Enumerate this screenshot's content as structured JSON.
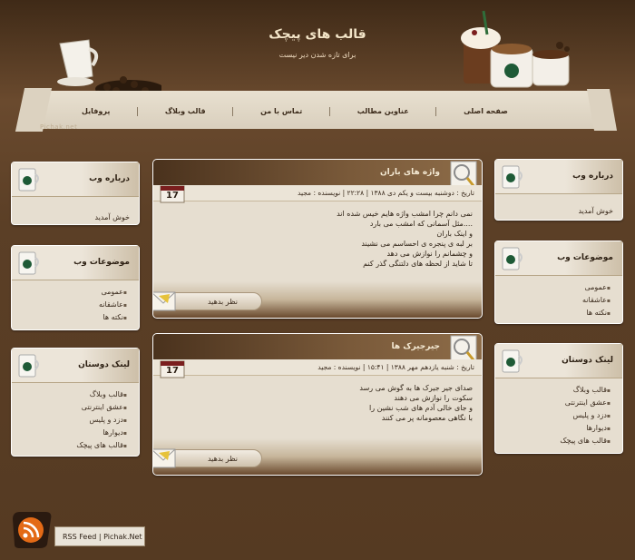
{
  "header": {
    "title": "قالب های پیچک",
    "description": "برای تازه شدن دیر نیست",
    "brand": "Pichak.net"
  },
  "nav": {
    "items": [
      "صفحه اصلی",
      "عناوین مطالب",
      "تماس با من",
      "قالب وبلاگ",
      "پروفایل"
    ]
  },
  "right_sidebar": {
    "about": {
      "title": "درباره وب",
      "text": "خوش آمدید"
    },
    "topics": {
      "title": "موضوعات وب",
      "items": [
        "عمومی",
        "عاشقانه",
        "نکته ها"
      ]
    },
    "links": {
      "title": "لینک دوستان",
      "items": [
        "قالب وبلاگ",
        "عشق اینترنتی",
        "دزد و پلیس",
        "دیوارها",
        "قالب های پیچک"
      ]
    }
  },
  "left_sidebar": {
    "about": {
      "title": "درباره وب",
      "text": "خوش آمدید"
    },
    "topics": {
      "title": "موضوعات وب",
      "items": [
        "عمومی",
        "عاشقانه",
        "نکته ها"
      ]
    },
    "links": {
      "title": "لینک دوستان",
      "items": [
        "قالب وبلاگ",
        "عشق اینترنتی",
        "دزد و پلیس",
        "دیوارها",
        "قالب های پیچک"
      ]
    }
  },
  "posts": [
    {
      "title": "واژه های باران",
      "day": "17",
      "meta": "تاریخ : دوشنبه بیست و یکم دی ۱۳۸۸ | ۲۲:۲۸ | نویسنده : مجید",
      "lines": [
        "نمی دانم چرا امشب واژه هایم خیس شده اند",
        "مثل آسمانی که امشب می بارد....",
        "و اینک باران",
        "بر لبه ی پنجره ی احساسم می نشیند",
        "و چشمانم را نوازش می دهد",
        "تا شاید از لحظه های دلتنگی گذر کنم"
      ],
      "comment_label": "نظر بدهید"
    },
    {
      "title": "جیرجیرک ها",
      "day": "17",
      "meta": "تاریخ : شنبه یازدهم مهر ۱۳۸۸ | ۱۵:۴۱ | نویسنده : مجید",
      "lines": [
        "صدای جیر جیرک ها به گوش می رسد",
        "سکوت را نوازش می دهند",
        "و جای خالی آدم های شب نشین را",
        "با نگاهی معصومانه پر می کنند"
      ],
      "comment_label": "نظر بدهید"
    }
  ],
  "rss": {
    "label": "RSS Feed | Pichak.Net"
  }
}
